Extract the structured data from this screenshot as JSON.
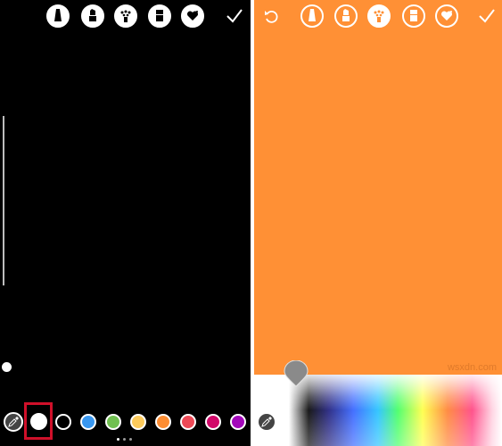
{
  "left_panel": {
    "toolbar": {
      "icons": [
        "marker-icon",
        "highlighter-icon",
        "chalk-icon",
        "eraser-icon",
        "heart-brush-icon"
      ],
      "check_icon": "check-icon"
    },
    "brush_size": {
      "level": 0.25
    },
    "palette": {
      "eyedropper_icon": "eyedropper-icon",
      "selected_color": "#ffffff",
      "colors": [
        "#ffffff",
        "#000000",
        "#3897f0",
        "#70c050",
        "#fdcb5c",
        "#fd8d32",
        "#ed4956",
        "#d10869",
        "#a307ba"
      ]
    },
    "page_dots": {
      "count": 3,
      "active": 0
    }
  },
  "right_panel": {
    "background_color": "#ff9035",
    "toolbar": {
      "undo_icon": "undo-icon",
      "icons": [
        "marker-icon",
        "highlighter-icon",
        "chalk-icon",
        "eraser-icon",
        "heart-brush-icon"
      ],
      "check_icon": "check-icon"
    },
    "picker": {
      "selected_color": "#8a8a8a"
    },
    "watermark": "wsxdn.com"
  }
}
